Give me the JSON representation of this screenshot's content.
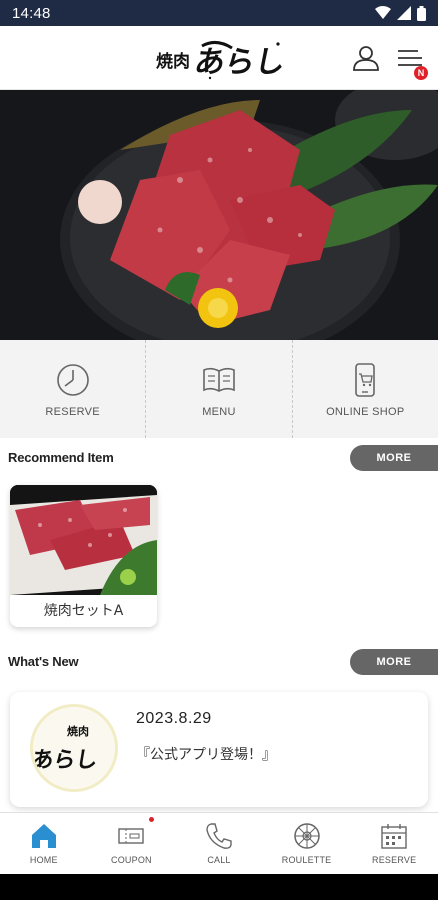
{
  "status_bar": {
    "time": "14:48"
  },
  "header": {
    "logo_text": "焼肉 あらし",
    "menu_badge": "N"
  },
  "quick_menu": [
    {
      "label": "RESERVE",
      "icon": "clock-icon"
    },
    {
      "label": "MENU",
      "icon": "book-icon"
    },
    {
      "label": "ONLINE SHOP",
      "icon": "phone-cart-icon"
    }
  ],
  "recommend": {
    "title": "Recommend Item",
    "more_label": "MORE",
    "items": [
      {
        "label": "焼肉セットA"
      }
    ]
  },
  "whats_new": {
    "title": "What's New",
    "more_label": "MORE",
    "items": [
      {
        "date": "2023.8.29",
        "text": "『公式アプリ登場！』"
      }
    ]
  },
  "bottom_nav": [
    {
      "label": "HOME",
      "icon": "home-icon",
      "active": true
    },
    {
      "label": "COUPON",
      "icon": "coupon-icon",
      "badge": true
    },
    {
      "label": "CALL",
      "icon": "phone-icon"
    },
    {
      "label": "ROULETTE",
      "icon": "roulette-icon"
    },
    {
      "label": "RESERVE",
      "icon": "calendar-icon"
    }
  ],
  "colors": {
    "status_bar": "#1f2a44",
    "accent_blue": "#2a8fd0",
    "badge_red": "#e0212a",
    "more_button": "#666666"
  }
}
